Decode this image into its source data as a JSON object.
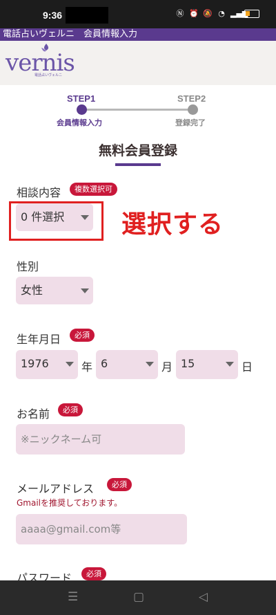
{
  "status": {
    "time": "9:36"
  },
  "header": {
    "title": "電話占いヴェルニ　会員情報入力"
  },
  "logo": {
    "text": "vernis",
    "sub": "電話占いヴェルニ"
  },
  "steps": {
    "step1": {
      "label": "STEP1",
      "sub": "会員情報入力"
    },
    "step2": {
      "label": "STEP2",
      "sub": "登録完了"
    }
  },
  "page_title": "無料会員登録",
  "consult": {
    "label": "相談内容",
    "badge": "複数選択可",
    "value": "0 件選択"
  },
  "annotation": "選択する",
  "gender": {
    "label": "性別",
    "value": "女性"
  },
  "birth": {
    "label": "生年月日",
    "badge": "必須",
    "year": "1976",
    "year_unit": "年",
    "month": "6",
    "month_unit": "月",
    "day": "15",
    "day_unit": "日"
  },
  "name": {
    "label": "お名前",
    "badge": "必須",
    "placeholder": "※ニックネーム可"
  },
  "email": {
    "label": "メールアドレス",
    "badge": "必須",
    "helper": "Gmailを推奨しております。",
    "placeholder": "aaaa@gmail.com等"
  },
  "password": {
    "label": "パスワード",
    "badge": "必須"
  },
  "nav": {
    "menu": "☰",
    "home": "▢",
    "back": "◁"
  }
}
